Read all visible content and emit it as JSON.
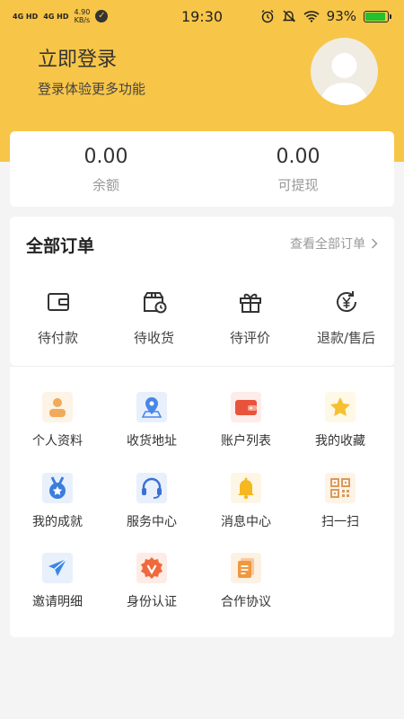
{
  "status_bar": {
    "signal1": "4G HD",
    "signal2": "4G HD",
    "net_speed_value": "4.90",
    "net_speed_unit": "KB/s",
    "time": "19:30",
    "battery": "93%",
    "battery_level": 0.93
  },
  "profile": {
    "login_title": "立即登录",
    "login_subtitle": "登录体验更多功能",
    "avatar_icon": "user-silhouette-icon"
  },
  "balance": {
    "items": [
      {
        "value": "0.00",
        "label": "余额"
      },
      {
        "value": "0.00",
        "label": "可提现"
      }
    ]
  },
  "orders": {
    "title": "全部订单",
    "view_all": "查看全部订单",
    "items": [
      {
        "label": "待付款",
        "icon": "wallet-icon"
      },
      {
        "label": "待收货",
        "icon": "delivery-box-icon"
      },
      {
        "label": "待评价",
        "icon": "gift-icon"
      },
      {
        "label": "退款/售后",
        "icon": "refund-yen-icon"
      }
    ]
  },
  "services": {
    "items": [
      {
        "label": "个人资料",
        "icon": "person-icon"
      },
      {
        "label": "收货地址",
        "icon": "location-pin-icon"
      },
      {
        "label": "账户列表",
        "icon": "wallet-card-icon"
      },
      {
        "label": "我的收藏",
        "icon": "star-icon"
      },
      {
        "label": "我的成就",
        "icon": "medal-icon"
      },
      {
        "label": "服务中心",
        "icon": "headset-icon"
      },
      {
        "label": "消息中心",
        "icon": "bell-icon"
      },
      {
        "label": "扫一扫",
        "icon": "qr-code-icon"
      },
      {
        "label": "邀请明细",
        "icon": "paper-plane-icon"
      },
      {
        "label": "身份认证",
        "icon": "verified-badge-icon"
      },
      {
        "label": "合作协议",
        "icon": "document-icon"
      }
    ]
  },
  "colors": {
    "brand_yellow": "#f7c548",
    "background": "#f4f4f4",
    "battery_green": "#21c130"
  }
}
